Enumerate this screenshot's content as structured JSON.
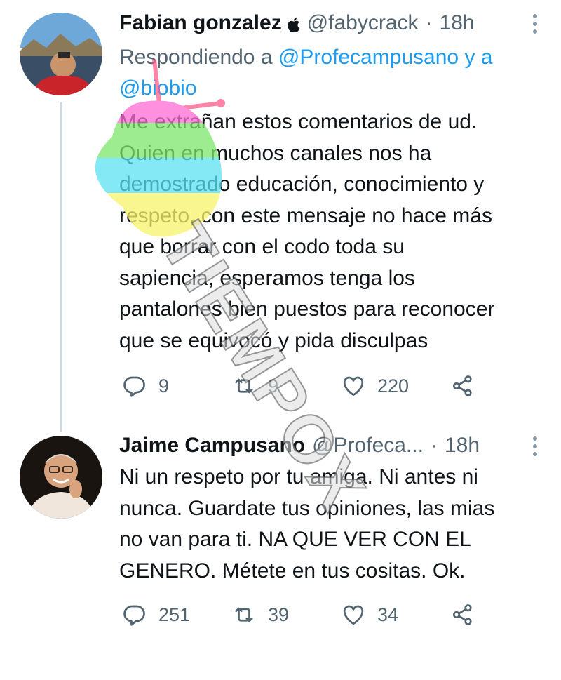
{
  "tweets": [
    {
      "name": "Fabian gonzalez",
      "handle": "@fabycrack",
      "dot": "·",
      "time": "18h",
      "reply_prefix": "Respondiendo a",
      "reply_mention_1": "@Profecampusano",
      "reply_joiner": "y a",
      "reply_mention_2": "@biobio",
      "lines": [
        "Me extrañan estos comentarios de ud.",
        "Quien en muchos canales nos ha",
        "demostrado educación, conocimiento y",
        "respeto, con este mensaje no hace más",
        "que borrar con el codo toda su",
        "sapiencia, esperamos tenga los",
        "pantalones bien puestos para reconocer",
        "que se equivocó y pida disculpas"
      ],
      "replies": "9",
      "retweets": "9",
      "likes": "220",
      "verified_badge_icon": "apple-icon"
    },
    {
      "name": "Jaime Campusano",
      "handle": "@Profeca...",
      "dot": "·",
      "time": "18h",
      "lines": [
        "Ni un respeto por tu amiga. Ni antes ni",
        "nunca. Guardate tus opiniones, las mias",
        "no van para ti. NA  QUE VER CON EL",
        "GENERO. Métete en tus cositas. Ok."
      ],
      "replies": "251",
      "retweets": "39",
      "likes": "34"
    }
  ],
  "watermark": "TIEMPOX",
  "colors": {
    "text": "#0f1419",
    "secondary": "#536471",
    "link": "#1d9bf0",
    "thread_line": "#cfd9de"
  }
}
